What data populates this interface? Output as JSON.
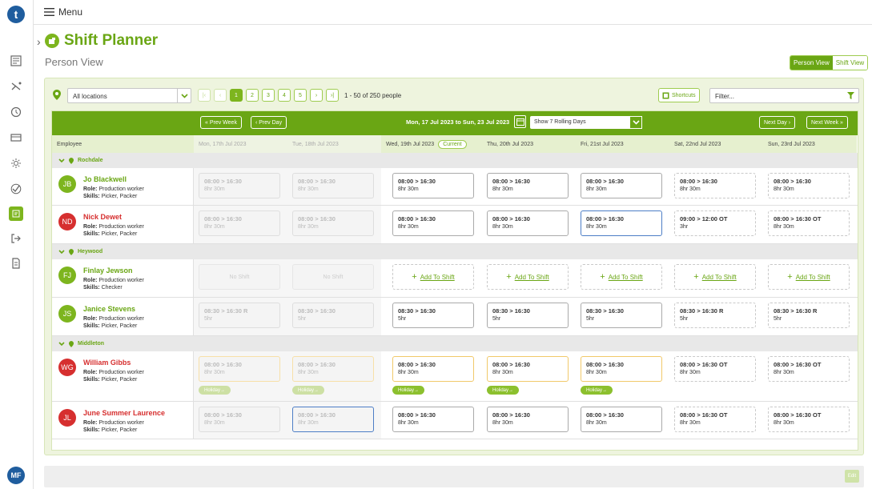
{
  "nav": {
    "logo": "t",
    "menu_label": "Menu",
    "user_initials": "MF"
  },
  "app": {
    "title": "Shift Planner",
    "subtitle": "Person View",
    "view_person": "Person View",
    "view_shift": "Shift View"
  },
  "toolbar": {
    "location": "All locations",
    "pages": [
      "1",
      "2",
      "3",
      "4",
      "5"
    ],
    "current_page": "1",
    "page_info": "1 - 50 of 250 people",
    "shortcuts": "Shortcuts",
    "filter_placeholder": "Filter..."
  },
  "grid": {
    "prev_week": "Prev Week",
    "prev_day": "Prev Day",
    "next_day": "Next Day",
    "next_week": "Next Week",
    "date_range": "Mon, 17 Jul 2023 to Sun, 23 Jul 2023",
    "rolling": "Show 7 Rolling Days",
    "employee_header": "Employee",
    "current_badge": "Current",
    "days": [
      "Mon, 17th Jul 2023",
      "Tue, 18th Jul 2023",
      "Wed, 19th Jul 2023",
      "Thu, 20th Jul 2023",
      "Fri, 21st Jul 2023",
      "Sat, 22nd Jul 2023",
      "Sun, 23rd Jul 2023"
    ],
    "groups": [
      "Rochdale",
      "Heywood",
      "Middleton"
    ],
    "role_label": "Role:",
    "skills_label": "Skills:",
    "add_to_shift": "Add To Shift",
    "no_shift": "No Shift",
    "holiday": "Holiday",
    "employees": [
      {
        "initials": "JB",
        "name": "Jo Blackwell",
        "role": "Production worker",
        "skills": "Picker, Packer",
        "shifts": [
          [
            "08:00 > 16:30",
            "8hr 30m"
          ],
          [
            "08:00 > 16:30",
            "8hr 30m"
          ],
          [
            "08:00 > 16:30",
            "8hr 30m"
          ],
          [
            "08:00 > 16:30",
            "8hr 30m"
          ],
          [
            "08:00 > 16:30",
            "8hr 30m"
          ],
          [
            "08:00 > 16:30",
            "8hr 30m"
          ],
          [
            "08:00 > 16:30",
            "8hr 30m"
          ]
        ]
      },
      {
        "initials": "ND",
        "name": "Nick Dewet",
        "role": "Production worker",
        "skills": "Picker, Packer",
        "shifts": [
          [
            "08:00 > 16:30",
            "8hr 30m"
          ],
          [
            "08:00 > 16:30",
            "8hr 30m"
          ],
          [
            "08:00 > 16:30",
            "8hr 30m"
          ],
          [
            "08:00 > 16:30",
            "8hr 30m"
          ],
          [
            "08:00 > 16:30",
            "8hr 30m"
          ],
          [
            "09:00 > 12:00 OT",
            "3hr"
          ],
          [
            "08:00 > 16:30 OT",
            "8hr 30m"
          ]
        ]
      },
      {
        "initials": "FJ",
        "name": "Finlay Jewson",
        "role": "Production worker",
        "skills": "Checker"
      },
      {
        "initials": "JS",
        "name": "Janice Stevens",
        "role": "Production worker",
        "skills": "Picker, Packer",
        "shifts": [
          [
            "08:30 > 16:30 R",
            "5hr"
          ],
          [
            "08:30 > 16:30",
            "5hr"
          ],
          [
            "08:30 > 16:30",
            "5hr"
          ],
          [
            "08:30 > 16:30",
            "5hr"
          ],
          [
            "08:30 > 16:30",
            "5hr"
          ],
          [
            "08:30 > 16:30 R",
            "5hr"
          ],
          [
            "08:30 > 16:30 R",
            "5hr"
          ]
        ]
      },
      {
        "initials": "WG",
        "name": "William Gibbs",
        "role": "Production worker",
        "skills": "Picker, Packer",
        "shifts": [
          [
            "08:00 > 16:30",
            "8hr 30m"
          ],
          [
            "08:00 > 16:30",
            "8hr 30m"
          ],
          [
            "08:00 > 16:30",
            "8hr 30m"
          ],
          [
            "08:00 > 16:30",
            "8hr 30m"
          ],
          [
            "08:00 > 16:30",
            "8hr 30m"
          ],
          [
            "08:00 > 16:30 OT",
            "8hr 30m"
          ],
          [
            "08:00 > 16:30 OT",
            "8hr 30m"
          ]
        ]
      },
      {
        "initials": "JL",
        "name": "June Summer Laurence",
        "role": "Production worker",
        "skills": "Picker, Packer",
        "shifts": [
          [
            "08:00 > 16:30",
            "8hr 30m"
          ],
          [
            "08:00 > 16:30",
            "8hr 30m"
          ],
          [
            "08:00 > 16:30",
            "8hr 30m"
          ],
          [
            "08:00 > 16:30",
            "8hr 30m"
          ],
          [
            "08:00 > 16:30",
            "8hr 30m"
          ],
          [
            "08:00 > 16:30 OT",
            "8hr 30m"
          ],
          [
            "08:00 > 16:30 OT",
            "8hr 30m"
          ]
        ]
      }
    ]
  },
  "footer": {
    "edit": "Edit"
  },
  "colors": {
    "accent": "#6aa614",
    "avatar_green": "#7db51e",
    "avatar_red": "#d62f2f",
    "holiday": "#8cc02e",
    "selected": "#4d7ec6"
  }
}
